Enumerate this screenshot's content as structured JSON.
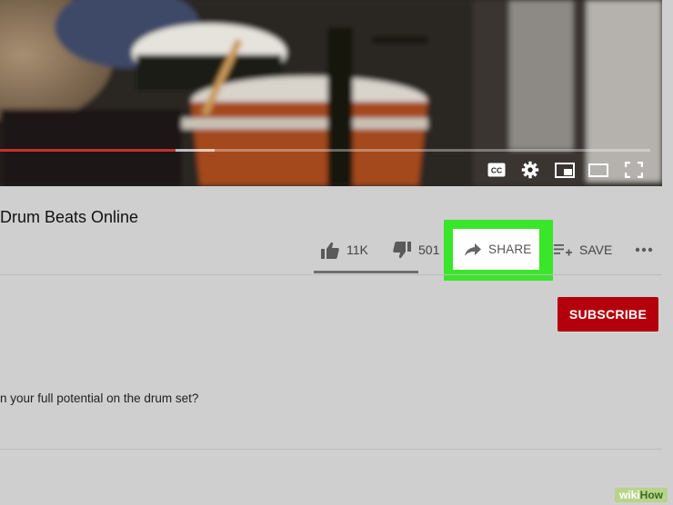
{
  "player": {
    "progress": 0.27,
    "buffered": 0.33,
    "controls": [
      {
        "name": "captions-icon",
        "glyph": "CC"
      },
      {
        "name": "settings-gear-icon"
      },
      {
        "name": "miniplayer-icon"
      },
      {
        "name": "theater-mode-icon"
      },
      {
        "name": "fullscreen-icon"
      }
    ]
  },
  "video": {
    "title": "Drum Beats Online"
  },
  "actions": {
    "like_count": "11K",
    "dislike_count": "501",
    "share_label": "SHARE",
    "save_label": "SAVE"
  },
  "channel": {
    "subscribe_label": "SUBSCRIBE"
  },
  "description": {
    "text": "n your full potential on the drum set?"
  },
  "watermark": {
    "part1": "wiki",
    "part2": "How"
  },
  "colors": {
    "highlight": "#39e629",
    "subscribe": "#b3000c",
    "progress": "#c4302b"
  }
}
